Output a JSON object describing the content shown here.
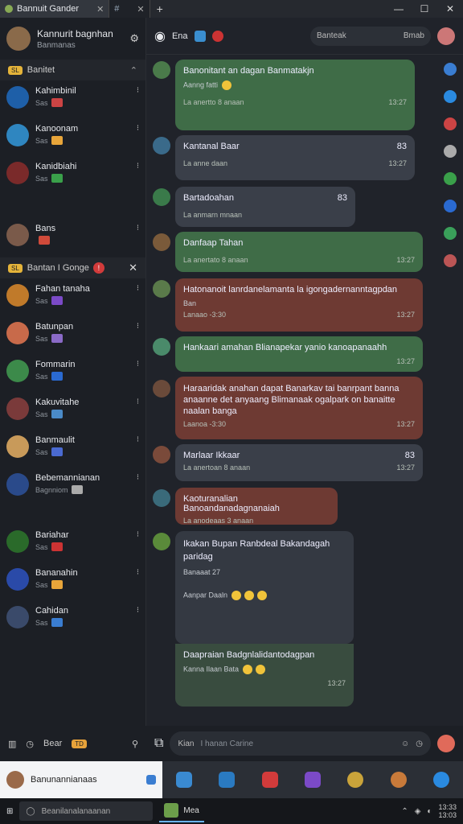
{
  "titlebar": {
    "tab1": "Bannuit Gander",
    "tab2": "#",
    "new_tab": "+",
    "min": "—",
    "max": "☐",
    "close": "✕"
  },
  "me": {
    "name": "Kannurit bagnhan",
    "status": "Banmanas"
  },
  "sections": {
    "s1": "Banitet",
    "s1_badge": "SL",
    "s2": "Bantan I Gonge",
    "s2_badge": "SL"
  },
  "chats": [
    {
      "name": "Kahimbinil",
      "preview": "Sas",
      "c1": "#1e5fa8",
      "e": "#c44"
    },
    {
      "name": "Kanoonam",
      "preview": "Sas",
      "c1": "#2f86c0",
      "e": "#e8a53a"
    },
    {
      "name": "Kanidbiahi",
      "preview": "Sas",
      "c1": "#7a2a2a",
      "e": "#3aa04a"
    },
    {
      "name": "Bans",
      "preview": "",
      "c1": "#7a5a4a",
      "e": "#d04a3a"
    },
    {
      "name": "Fahan tanaha",
      "preview": "Sas",
      "c1": "#c07a2a",
      "e": "#7b4ac7"
    },
    {
      "name": "Batunpan",
      "preview": "Sas",
      "c1": "#c86a4a",
      "e": "#8a6ac7"
    },
    {
      "name": "Fommarin",
      "preview": "Sas",
      "c1": "#3c8a4a",
      "e": "#2a6ad1"
    },
    {
      "name": "Kakuvitahe",
      "preview": "Sas",
      "c1": "#7a3a3a",
      "e": "#4a8ac7"
    },
    {
      "name": "Banmaulit",
      "preview": "Sas",
      "c1": "#c89a5a",
      "e": "#4a6ad1"
    },
    {
      "name": "Bebemannianan",
      "preview": "Bagnniom",
      "c1": "#2a4a8a",
      "e": "#aaa"
    },
    {
      "name": "Bariahar",
      "preview": "Sas",
      "c1": "#2a6a2a",
      "e": "#c33"
    },
    {
      "name": "Bananahin",
      "preview": "Sas",
      "c1": "#2a4aa8",
      "e": "#e8a53a"
    },
    {
      "name": "Cahidan",
      "preview": "Sas",
      "c1": "#3a4a6a",
      "e": "#3a7dd1"
    }
  ],
  "sidebar_bottom": {
    "label": "Bear",
    "tag": "TD"
  },
  "header": {
    "title": "Ena",
    "search_label": "Banteak",
    "search_value": "Bmab"
  },
  "messages": [
    {
      "text": "Banonitant an dagan Banmatakjn",
      "sub": "Aanng fatti",
      "meta": "La anertto 8 anaan",
      "time": "13:27"
    },
    {
      "text": "Kantanal Baar",
      "sub": "",
      "meta": "La anne daan",
      "time": "13:27",
      "num": "83"
    },
    {
      "text": "Bartadoahan",
      "sub": "",
      "meta": "La anmarn mnaan",
      "time": "",
      "num": "83"
    },
    {
      "text": "Danfaap Tahan",
      "sub": "",
      "meta": "La anertato 8 anaan",
      "time": "13:27"
    },
    {
      "text": "Hatonanoit lanrdanelamanta la igongadernanntagpdan",
      "sub": "Ban",
      "meta": "Lanaao -3:30",
      "time": "13:27"
    },
    {
      "text": "Hankaari amahan Blianapekar yanio kanoapanaahh",
      "sub": "",
      "meta": "",
      "time": "13:27"
    },
    {
      "text": "Haraaridak anahan dapat Banarkav tai banrpant banna anaanne det anyaang Blimanaak ogalpark on banaitte naalan banga",
      "sub": "",
      "meta": "Laanoa -3:30",
      "time": "13:27"
    },
    {
      "text": "Marlaar Ikkaar",
      "sub": "",
      "meta": "La anertoan 8 anaan",
      "time": "13:27",
      "num": "83"
    },
    {
      "text": "Kaoturanalian Banoandanadagnanaiah",
      "sub": "",
      "meta": "La anodeaas 3 anaan",
      "time": ""
    },
    {
      "text": "Ikakan Bupan Ranbdeal Bakandagah paridag",
      "sub": "Banaaat 27",
      "sub2": "Aanpar Daaln",
      "meta": "",
      "time": ""
    },
    {
      "text": "Daapraian Badgnlalidantodagpan",
      "sub": "Kanna Ilaan Bata",
      "meta": "",
      "time": "13:27"
    }
  ],
  "composer": {
    "label": "Kian",
    "placeholder": "I hanan Carine"
  },
  "dock": {
    "active_label": "Banunannianaas"
  },
  "taskbar": {
    "search": "Beanilanalanaanan",
    "app": "Mea",
    "time": "13:33",
    "date": "13:03"
  },
  "colors": {
    "accent": "#3a8ecf",
    "green_bubble": "#3f6c47",
    "red_bubble": "#6e3a33",
    "grey_bubble": "#3a3f49"
  }
}
